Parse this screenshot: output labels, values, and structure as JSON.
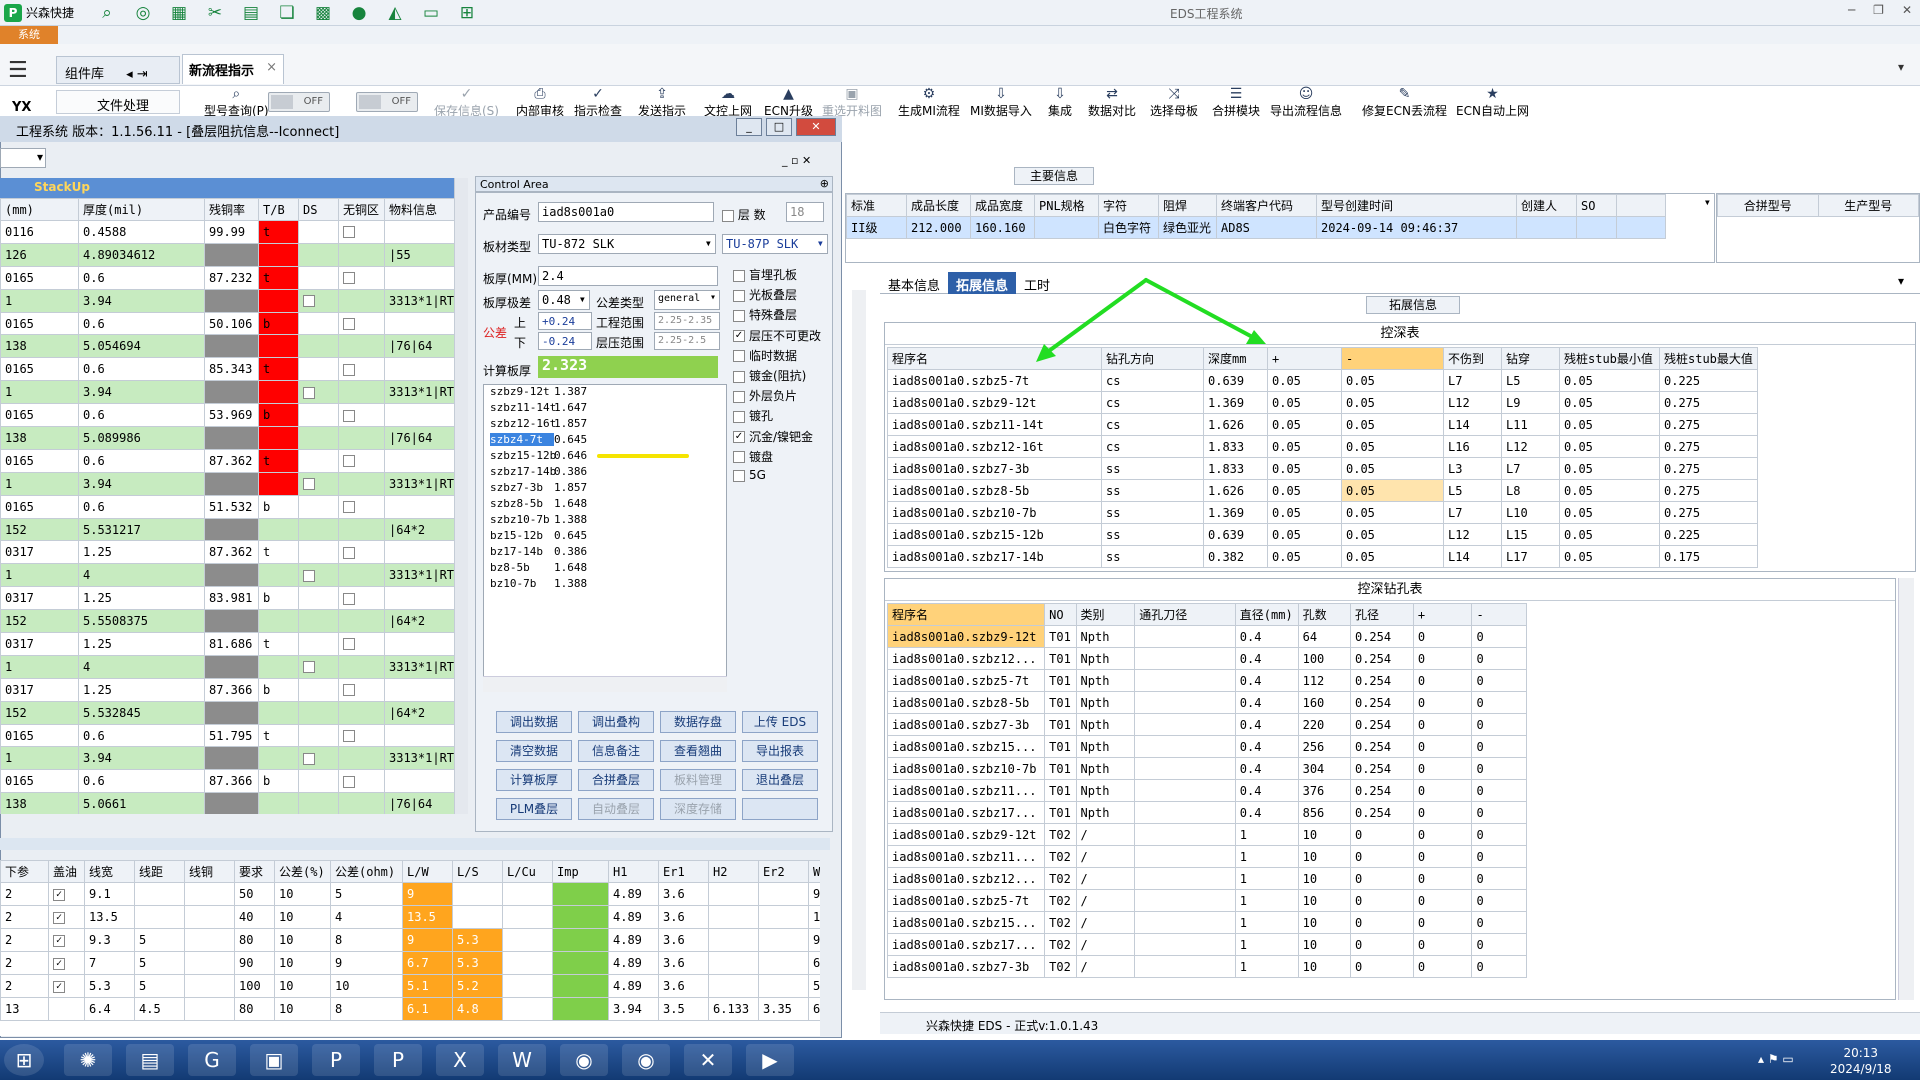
{
  "topbar": {
    "brand": "兴森快捷",
    "title": "EDS工程系统",
    "min": "─",
    "max": "❐",
    "close": "✕"
  },
  "sys_button": "系统",
  "tabs": {
    "lib": "组件库",
    "new_flow": "新流程指示",
    "close": "×",
    "file": "文件处理",
    "yx": "YX"
  },
  "toggles": [
    "OFF",
    "OFF"
  ],
  "toolbar": [
    "型号查询(P)",
    "保存信息(S)",
    "内部审核",
    "指示检查",
    "发送指示",
    "文控上网",
    "ECN升级",
    "重选开料图",
    "生成MI流程",
    "MI数据导入",
    "集成",
    "数据对比",
    "选择母板",
    "合拼模块",
    "导出流程信息",
    "修复ECN丢流程",
    "ECN自动上网"
  ],
  "main_info": {
    "label": "主要信息",
    "headers": [
      "标准",
      "成品长度",
      "成品宽度",
      "PNL规格",
      "字符",
      "阻焊",
      "终端客户代码",
      "型号创建时间",
      "创建人",
      "SO"
    ],
    "row": [
      "II级",
      "212.000",
      "160.160",
      "",
      "白色字符",
      "绿色亚光",
      "AD8S",
      "2024-09-14 09:46:37",
      "",
      ""
    ],
    "right_headers": [
      "合拼型号",
      "生产型号"
    ]
  },
  "right_tabs": {
    "basic": "基本信息",
    "extend": "拓展信息",
    "work": "工时",
    "section": "拓展信息"
  },
  "depth": {
    "title": "控深表",
    "headers": [
      "程序名",
      "钻孔方向",
      "深度mm",
      "+",
      "-",
      "不伤到",
      "钻穿",
      "残桩stub最小值",
      "残桩stub最大值"
    ],
    "rows": [
      [
        "iad8s001a0.szbz5-7t",
        "cs",
        "0.639",
        "0.05",
        "0.05",
        "L7",
        "L5",
        "0.05",
        "0.225"
      ],
      [
        "iad8s001a0.szbz9-12t",
        "cs",
        "1.369",
        "0.05",
        "0.05",
        "L12",
        "L9",
        "0.05",
        "0.275"
      ],
      [
        "iad8s001a0.szbz11-14t",
        "cs",
        "1.626",
        "0.05",
        "0.05",
        "L14",
        "L11",
        "0.05",
        "0.275"
      ],
      [
        "iad8s001a0.szbz12-16t",
        "cs",
        "1.833",
        "0.05",
        "0.05",
        "L16",
        "L12",
        "0.05",
        "0.275"
      ],
      [
        "iad8s001a0.szbz7-3b",
        "ss",
        "1.833",
        "0.05",
        "0.05",
        "L3",
        "L7",
        "0.05",
        "0.275"
      ],
      [
        "iad8s001a0.szbz8-5b",
        "ss",
        "1.626",
        "0.05",
        "0.05",
        "L5",
        "L8",
        "0.05",
        "0.275"
      ],
      [
        "iad8s001a0.szbz10-7b",
        "ss",
        "1.369",
        "0.05",
        "0.05",
        "L7",
        "L10",
        "0.05",
        "0.275"
      ],
      [
        "iad8s001a0.szbz15-12b",
        "ss",
        "0.639",
        "0.05",
        "0.05",
        "L12",
        "L15",
        "0.05",
        "0.225"
      ],
      [
        "iad8s001a0.szbz17-14b",
        "ss",
        "0.382",
        "0.05",
        "0.05",
        "L14",
        "L17",
        "0.05",
        "0.175"
      ]
    ]
  },
  "drill": {
    "title": "控深钻孔表",
    "headers": [
      "程序名",
      "NO",
      "类别",
      "通孔刀径",
      "直径(mm)",
      "孔数",
      "孔径",
      "+",
      "-"
    ],
    "rows": [
      [
        "iad8s001a0.szbz9-12t",
        "T01",
        "Npth",
        "",
        "0.4",
        "64",
        "0.254",
        "0",
        "0"
      ],
      [
        "iad8s001a0.szbz12...",
        "T01",
        "Npth",
        "",
        "0.4",
        "100",
        "0.254",
        "0",
        "0"
      ],
      [
        "iad8s001a0.szbz5-7t",
        "T01",
        "Npth",
        "",
        "0.4",
        "112",
        "0.254",
        "0",
        "0"
      ],
      [
        "iad8s001a0.szbz8-5b",
        "T01",
        "Npth",
        "",
        "0.4",
        "160",
        "0.254",
        "0",
        "0"
      ],
      [
        "iad8s001a0.szbz7-3b",
        "T01",
        "Npth",
        "",
        "0.4",
        "220",
        "0.254",
        "0",
        "0"
      ],
      [
        "iad8s001a0.szbz15...",
        "T01",
        "Npth",
        "",
        "0.4",
        "256",
        "0.254",
        "0",
        "0"
      ],
      [
        "iad8s001a0.szbz10-7b",
        "T01",
        "Npth",
        "",
        "0.4",
        "304",
        "0.254",
        "0",
        "0"
      ],
      [
        "iad8s001a0.szbz11...",
        "T01",
        "Npth",
        "",
        "0.4",
        "376",
        "0.254",
        "0",
        "0"
      ],
      [
        "iad8s001a0.szbz17...",
        "T01",
        "Npth",
        "",
        "0.4",
        "856",
        "0.254",
        "0",
        "0"
      ],
      [
        "iad8s001a0.szbz9-12t",
        "T02",
        "/",
        "",
        "1",
        "10",
        "0",
        "0",
        "0"
      ],
      [
        "iad8s001a0.szbz11...",
        "T02",
        "/",
        "",
        "1",
        "10",
        "0",
        "0",
        "0"
      ],
      [
        "iad8s001a0.szbz12...",
        "T02",
        "/",
        "",
        "1",
        "10",
        "0",
        "0",
        "0"
      ],
      [
        "iad8s001a0.szbz5-7t",
        "T02",
        "/",
        "",
        "1",
        "10",
        "0",
        "0",
        "0"
      ],
      [
        "iad8s001a0.szbz15...",
        "T02",
        "/",
        "",
        "1",
        "10",
        "0",
        "0",
        "0"
      ],
      [
        "iad8s001a0.szbz17...",
        "T02",
        "/",
        "",
        "1",
        "10",
        "0",
        "0",
        "0"
      ],
      [
        "iad8s001a0.szbz7-3b",
        "T02",
        "/",
        "",
        "1",
        "10",
        "0",
        "0",
        "0"
      ]
    ]
  },
  "dialog": {
    "title": "工程系统  版本：1.1.56.11 - [叠层阻抗信息--Iconnect]",
    "stack_label": "StackUp"
  },
  "stack": {
    "headers": [
      "(mm)",
      "厚度(mil)",
      "残铜率",
      "T/B",
      "DS",
      "无铜区",
      "物料信息"
    ],
    "rows": [
      {
        "c": [
          "0116",
          "0.4588",
          "99.99",
          "t",
          "",
          "",
          ""
        ],
        "g": false,
        "red": true,
        "gray": false,
        "chkpos": 5
      },
      {
        "c": [
          "126",
          "4.89034612",
          "",
          "",
          "",
          "",
          "|55"
        ],
        "g": true,
        "red": true,
        "gray": true,
        "chkpos": -1
      },
      {
        "c": [
          "0165",
          "0.6",
          "87.232",
          "t",
          "",
          "",
          ""
        ],
        "g": false,
        "red": true,
        "gray": false,
        "chkpos": 5
      },
      {
        "c": [
          "1",
          "3.94",
          "",
          "",
          "",
          "",
          "3313*1|RTF"
        ],
        "g": true,
        "red": true,
        "gray": true,
        "chkpos": 4
      },
      {
        "c": [
          "0165",
          "0.6",
          "50.106",
          "b",
          "",
          "",
          ""
        ],
        "g": false,
        "red": true,
        "gray": false,
        "chkpos": 5
      },
      {
        "c": [
          "138",
          "5.054694",
          "",
          "",
          "",
          "",
          "|76|64"
        ],
        "g": true,
        "red": true,
        "gray": true,
        "chkpos": -1
      },
      {
        "c": [
          "0165",
          "0.6",
          "85.343",
          "t",
          "",
          "",
          ""
        ],
        "g": false,
        "red": true,
        "gray": false,
        "chkpos": 5
      },
      {
        "c": [
          "1",
          "3.94",
          "",
          "",
          "",
          "",
          "3313*1|RTF"
        ],
        "g": true,
        "red": true,
        "gray": true,
        "chkpos": 4
      },
      {
        "c": [
          "0165",
          "0.6",
          "53.969",
          "b",
          "",
          "",
          ""
        ],
        "g": false,
        "red": true,
        "gray": false,
        "chkpos": 5
      },
      {
        "c": [
          "138",
          "5.089986",
          "",
          "",
          "",
          "",
          "|76|64"
        ],
        "g": true,
        "red": true,
        "gray": true,
        "chkpos": -1
      },
      {
        "c": [
          "0165",
          "0.6",
          "87.362",
          "t",
          "",
          "",
          ""
        ],
        "g": false,
        "red": true,
        "gray": false,
        "chkpos": 5
      },
      {
        "c": [
          "1",
          "3.94",
          "",
          "",
          "",
          "",
          "3313*1|RTF"
        ],
        "g": true,
        "red": true,
        "gray": true,
        "chkpos": 4
      },
      {
        "c": [
          "0165",
          "0.6",
          "51.532",
          "b",
          "",
          "",
          ""
        ],
        "g": false,
        "red": false,
        "gray": false,
        "chkpos": 5
      },
      {
        "c": [
          "152",
          "5.531217",
          "",
          "",
          "",
          "",
          "|64*2"
        ],
        "g": true,
        "red": false,
        "gray": true,
        "chkpos": -1
      },
      {
        "c": [
          "0317",
          "1.25",
          "87.362",
          "t",
          "",
          "",
          ""
        ],
        "g": false,
        "red": false,
        "gray": false,
        "chkpos": 5
      },
      {
        "c": [
          "1",
          "4",
          "",
          "",
          "",
          "",
          "3313*1|RTF"
        ],
        "g": true,
        "red": false,
        "gray": true,
        "chkpos": 4
      },
      {
        "c": [
          "0317",
          "1.25",
          "83.981",
          "b",
          "",
          "",
          ""
        ],
        "g": false,
        "red": false,
        "gray": false,
        "chkpos": 5
      },
      {
        "c": [
          "152",
          "5.5508375",
          "",
          "",
          "",
          "",
          "|64*2"
        ],
        "g": true,
        "red": false,
        "gray": true,
        "chkpos": -1
      },
      {
        "c": [
          "0317",
          "1.25",
          "81.686",
          "t",
          "",
          "",
          ""
        ],
        "g": false,
        "red": false,
        "gray": false,
        "chkpos": 5
      },
      {
        "c": [
          "1",
          "4",
          "",
          "",
          "",
          "",
          "3313*1|RTF"
        ],
        "g": true,
        "red": false,
        "gray": true,
        "chkpos": 4
      },
      {
        "c": [
          "0317",
          "1.25",
          "87.366",
          "b",
          "",
          "",
          ""
        ],
        "g": false,
        "red": false,
        "gray": false,
        "chkpos": 5
      },
      {
        "c": [
          "152",
          "5.532845",
          "",
          "",
          "",
          "",
          "|64*2"
        ],
        "g": true,
        "red": false,
        "gray": true,
        "chkpos": -1
      },
      {
        "c": [
          "0165",
          "0.6",
          "51.795",
          "t",
          "",
          "",
          ""
        ],
        "g": false,
        "red": false,
        "gray": false,
        "chkpos": 5
      },
      {
        "c": [
          "1",
          "3.94",
          "",
          "",
          "",
          "",
          "3313*1|RTF"
        ],
        "g": true,
        "red": false,
        "gray": true,
        "chkpos": 4
      },
      {
        "c": [
          "0165",
          "0.6",
          "87.366",
          "b",
          "",
          "",
          ""
        ],
        "g": false,
        "red": false,
        "gray": false,
        "chkpos": 5
      },
      {
        "c": [
          "138",
          "5.0661",
          "",
          "",
          "",
          "",
          "|76|64"
        ],
        "g": true,
        "red": false,
        "gray": true,
        "chkpos": -1
      }
    ]
  },
  "control": {
    "head": "Control Area",
    "product_no_label": "产品编号",
    "product_no": "iad8s001a0",
    "layers_label": "层  数",
    "layers": "18",
    "board_type_label": "板材类型",
    "board_type": "TU-872 SLK",
    "board_type2": "TU-87P SLK",
    "thickness_label": "板厚(MM)",
    "thickness": "2.4",
    "tol_level_label": "板厚极差",
    "tol_level": "0.48",
    "tol_type_label": "公差类型",
    "tol_type": "general",
    "tol_label": "公差",
    "up_label": "上",
    "up": "+0.24",
    "down_label": "下",
    "down": "-0.24",
    "eng_range_label": "工程范围",
    "eng_range": "2.25-2.35",
    "press_range_label": "层压范围",
    "press_range": "2.25-2.5",
    "calc_label": "计算板厚",
    "calc": "2.323",
    "list": [
      [
        "szbz9-12t",
        "1.387"
      ],
      [
        "szbz11-14t",
        "1.647"
      ],
      [
        "szbz12-16t",
        "1.857"
      ],
      [
        "szbz4-7t",
        "0.645"
      ],
      [
        "szbz15-12b",
        "0.646"
      ],
      [
        "szbz17-14b",
        "0.386"
      ],
      [
        "szbz7-3b",
        "1.857"
      ],
      [
        "szbz8-5b",
        "1.648"
      ],
      [
        "szbz10-7b",
        "1.388"
      ],
      [
        "bz15-12b",
        "0.645"
      ],
      [
        "bz17-14b",
        "0.386"
      ],
      [
        "bz8-5b",
        "1.648"
      ],
      [
        "bz10-7b",
        "1.388"
      ]
    ],
    "checks": [
      [
        "盲埋孔板",
        false
      ],
      [
        "光板叠层",
        false
      ],
      [
        "特殊叠层",
        false
      ],
      [
        "层压不可更改",
        true
      ],
      [
        "临时数据",
        false
      ],
      [
        "镀金(阻抗)",
        false
      ],
      [
        "外层负片",
        false
      ],
      [
        "镀孔",
        false
      ],
      [
        "沉金/镍钯金",
        true
      ],
      [
        "镀盘",
        false
      ],
      [
        "5G",
        false
      ]
    ],
    "buttons": [
      [
        "调出数据",
        false
      ],
      [
        "调出叠构",
        false
      ],
      [
        "数据存盘",
        false
      ],
      [
        "上传 EDS",
        false
      ],
      [
        "清空数据",
        false
      ],
      [
        "信息备注",
        false
      ],
      [
        "查看翘曲",
        false
      ],
      [
        "导出报表",
        false
      ],
      [
        "计算板厚",
        false
      ],
      [
        "合拼叠层",
        false
      ],
      [
        "板料管理",
        true
      ],
      [
        "退出叠层",
        false
      ],
      [
        "PLM叠层",
        false
      ],
      [
        "自动叠层",
        true
      ],
      [
        "深度存储",
        true
      ],
      [
        "",
        false
      ]
    ]
  },
  "imp": {
    "headers": [
      "下参",
      "盖油",
      "线宽",
      "线距",
      "线铜",
      "要求",
      "公差(%)",
      "公差(ohm)",
      "L/W",
      "L/S",
      "L/Cu",
      "Imp",
      "H1",
      "Er1",
      "H2",
      "Er2",
      "W"
    ],
    "rows": [
      [
        "2",
        "✓",
        "9.1",
        "",
        "",
        "50",
        "10",
        "5",
        "9",
        "",
        "",
        "",
        "4.89",
        "3.6",
        "",
        "",
        "9"
      ],
      [
        "2",
        "✓",
        "13.5",
        "",
        "",
        "40",
        "10",
        "4",
        "13.5",
        "",
        "",
        "",
        "4.89",
        "3.6",
        "",
        "",
        "1"
      ],
      [
        "2",
        "✓",
        "9.3",
        "5",
        "",
        "80",
        "10",
        "8",
        "9",
        "5.3",
        "",
        "",
        "4.89",
        "3.6",
        "",
        "",
        "9"
      ],
      [
        "2",
        "✓",
        "7",
        "5",
        "",
        "90",
        "10",
        "9",
        "6.7",
        "5.3",
        "",
        "",
        "4.89",
        "3.6",
        "",
        "",
        "6"
      ],
      [
        "2",
        "✓",
        "5.3",
        "5",
        "",
        "100",
        "10",
        "10",
        "5.1",
        "5.2",
        "",
        "",
        "4.89",
        "3.6",
        "",
        "",
        "5"
      ],
      [
        "13",
        "",
        "6.4",
        "4.5",
        "",
        "80",
        "10",
        "8",
        "6.1",
        "4.8",
        "",
        "",
        "3.94",
        "3.5",
        "6.133",
        "3.35",
        "6"
      ]
    ]
  },
  "status": "兴森快捷 EDS - 正式v:1.0.1.43",
  "clock": {
    "time": "20:13",
    "date": "2024/9/18"
  },
  "colors": {
    "accent": "#2d5fa8",
    "green": "#1aa64a",
    "orange": "#ffa51e",
    "red": "#ff0000"
  }
}
